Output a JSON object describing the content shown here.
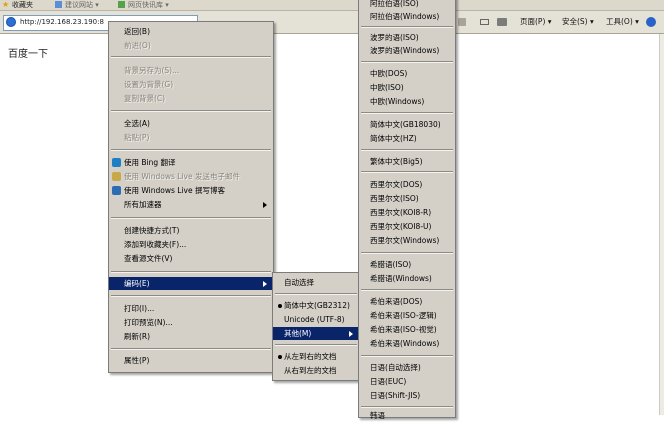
{
  "browser": {
    "favorites_label": "收藏夹",
    "fav_item_1": "建议网站 ▾",
    "fav_item_2": "网页快讯库 ▾",
    "address": "http://192.168.23.190:8",
    "toolbar": {
      "page_label": "页面(P) ▾",
      "safety_label": "安全(S) ▾",
      "tools_label": "工具(O) ▾",
      "help_label": "?▾"
    }
  },
  "page": {
    "text": "百度一下"
  },
  "context_menu": {
    "items": [
      {
        "label": "返回(B)",
        "enabled": true
      },
      {
        "label": "前进(O)",
        "enabled": false
      },
      {
        "label": "背景另存为(S)...",
        "enabled": false
      },
      {
        "label": "设置为背景(G)",
        "enabled": false
      },
      {
        "label": "复制背景(C)",
        "enabled": false
      },
      {
        "label": "全选(A)",
        "enabled": true
      },
      {
        "label": "粘贴(P)",
        "enabled": false
      },
      {
        "label": "使用 Bing 翻译",
        "enabled": true
      },
      {
        "label": "使用 Windows Live 发送电子邮件",
        "enabled": false
      },
      {
        "label": "使用 Windows Live 撰写博客",
        "enabled": true
      },
      {
        "label": "所有加速器",
        "enabled": true
      },
      {
        "label": "创建快捷方式(T)",
        "enabled": true
      },
      {
        "label": "添加到收藏夹(F)...",
        "enabled": true
      },
      {
        "label": "查看源文件(V)",
        "enabled": true
      },
      {
        "label": "编码(E)",
        "enabled": true
      },
      {
        "label": "打印(I)...",
        "enabled": true
      },
      {
        "label": "打印预览(N)...",
        "enabled": true
      },
      {
        "label": "刷新(R)",
        "enabled": true
      },
      {
        "label": "属性(P)",
        "enabled": true
      }
    ]
  },
  "encoding_menu": {
    "items": [
      {
        "label": "自动选择"
      },
      {
        "label": "简体中文(GB2312)"
      },
      {
        "label": "Unicode (UTF-8)"
      },
      {
        "label": "其他(M)"
      },
      {
        "label": "从左到右的文档"
      },
      {
        "label": "从右到左的文档"
      }
    ]
  },
  "other_menu": {
    "items": [
      {
        "label": "阿拉伯语(ISO)"
      },
      {
        "label": "阿拉伯语(Windows)"
      },
      {
        "label": "波罗的语(ISO)"
      },
      {
        "label": "波罗的语(Windows)"
      },
      {
        "label": "中欧(DOS)"
      },
      {
        "label": "中欧(ISO)"
      },
      {
        "label": "中欧(Windows)"
      },
      {
        "label": "简体中文(GB18030)"
      },
      {
        "label": "简体中文(HZ)"
      },
      {
        "label": "繁体中文(Big5)"
      },
      {
        "label": "西里尔文(DOS)"
      },
      {
        "label": "西里尔文(ISO)"
      },
      {
        "label": "西里尔文(KOI8-R)"
      },
      {
        "label": "西里尔文(KOI8-U)"
      },
      {
        "label": "西里尔文(Windows)"
      },
      {
        "label": "希腊语(ISO)"
      },
      {
        "label": "希腊语(Windows)"
      },
      {
        "label": "希伯来语(DOS)"
      },
      {
        "label": "希伯来语(ISO-逻辑)"
      },
      {
        "label": "希伯来语(ISO-视觉)"
      },
      {
        "label": "希伯来语(Windows)"
      },
      {
        "label": "日语(自动选择)"
      },
      {
        "label": "日语(EUC)"
      },
      {
        "label": "日语(Shift-JIS)"
      },
      {
        "label": "韩语"
      }
    ]
  },
  "colors": {
    "selection": "#0a246a",
    "menu_bg": "#d4d0c8"
  }
}
